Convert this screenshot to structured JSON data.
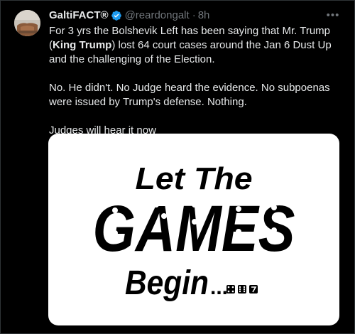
{
  "tweet": {
    "display_name": "GaltiFACT®",
    "handle": "@reardongalt",
    "separator": "·",
    "time": "8h",
    "avatar_icon": "avatar-photo",
    "verified_icon": "verified-badge-icon",
    "more_icon": "more-options-icon",
    "text": {
      "p1_before_bold1": "For 3 yrs the Bolshevik Left has been saying that Mr. Trump (",
      "bold1": "King Trump",
      "p1_after_bold1": ") lost 64 court cases around the Jan 6 Dust Up and the challenging of the Election.",
      "p2": "No. He didn't. No Judge heard the evidence. No subpoenas were issued by Trump's defense. Nothing.",
      "p3": "Judges will hear it now"
    },
    "media": {
      "line1": "Let The",
      "line2": "GAMES",
      "line3": "Begin",
      "ellipsis": "...",
      "dice_icons": [
        "die-four-icon",
        "die-six-icon",
        "die-seven-icon"
      ]
    },
    "colors": {
      "background": "#000000",
      "text": "#e7e9ea",
      "muted": "#71767b",
      "verified": "#1d9bf0",
      "media_bg": "#ffffff",
      "media_ink": "#000000"
    }
  }
}
